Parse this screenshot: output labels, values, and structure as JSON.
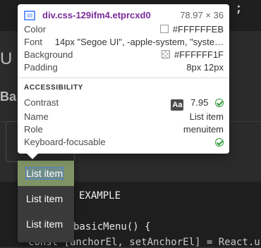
{
  "background": {
    "top_code_fragment": ";",
    "left_title_fragment": "U",
    "left_subtitle_fragment": "Ba",
    "code": {
      "line1": "EXAMPLE",
      "line2": "basicMenu() {",
      "line3": "const [anchorEl, setAnchorEl] = React.u"
    }
  },
  "menu": {
    "items": [
      {
        "label": "List item"
      },
      {
        "label": "List item"
      },
      {
        "label": "List item"
      }
    ],
    "colors": {
      "selected_bg": "#7f9466",
      "menu_bg": "#3a3a3a",
      "text": "#FFFFFF"
    }
  },
  "inspector_tooltip": {
    "selector": "div.css-129ifm4.etprcxd0",
    "dimensions": "78.97 × 36",
    "rows": {
      "color": {
        "key": "Color",
        "value": "#FFFFFFEB"
      },
      "font": {
        "key": "Font",
        "value": "14px \"Segoe UI\", -apple-system, \"syste…"
      },
      "background": {
        "key": "Background",
        "value": "#FFFFFF1F"
      },
      "padding": {
        "key": "Padding",
        "value": "8px 12px"
      }
    },
    "accessibility": {
      "title": "ACCESSIBILITY",
      "contrast": {
        "key": "Contrast",
        "badge": "Aa",
        "value": "7.95"
      },
      "name": {
        "key": "Name",
        "value": "List item"
      },
      "role": {
        "key": "Role",
        "value": "menuitem"
      },
      "keyboard_focusable": {
        "key": "Keyboard-focusable"
      }
    },
    "colors": {
      "selector_purple": "#7a2b9a",
      "check_green": "#2e9b3b"
    },
    "icons": [
      "element-inspector-icon",
      "color-swatch-icon",
      "transparent-swatch-icon",
      "contrast-badge-icon",
      "check-circle-icon"
    ]
  }
}
